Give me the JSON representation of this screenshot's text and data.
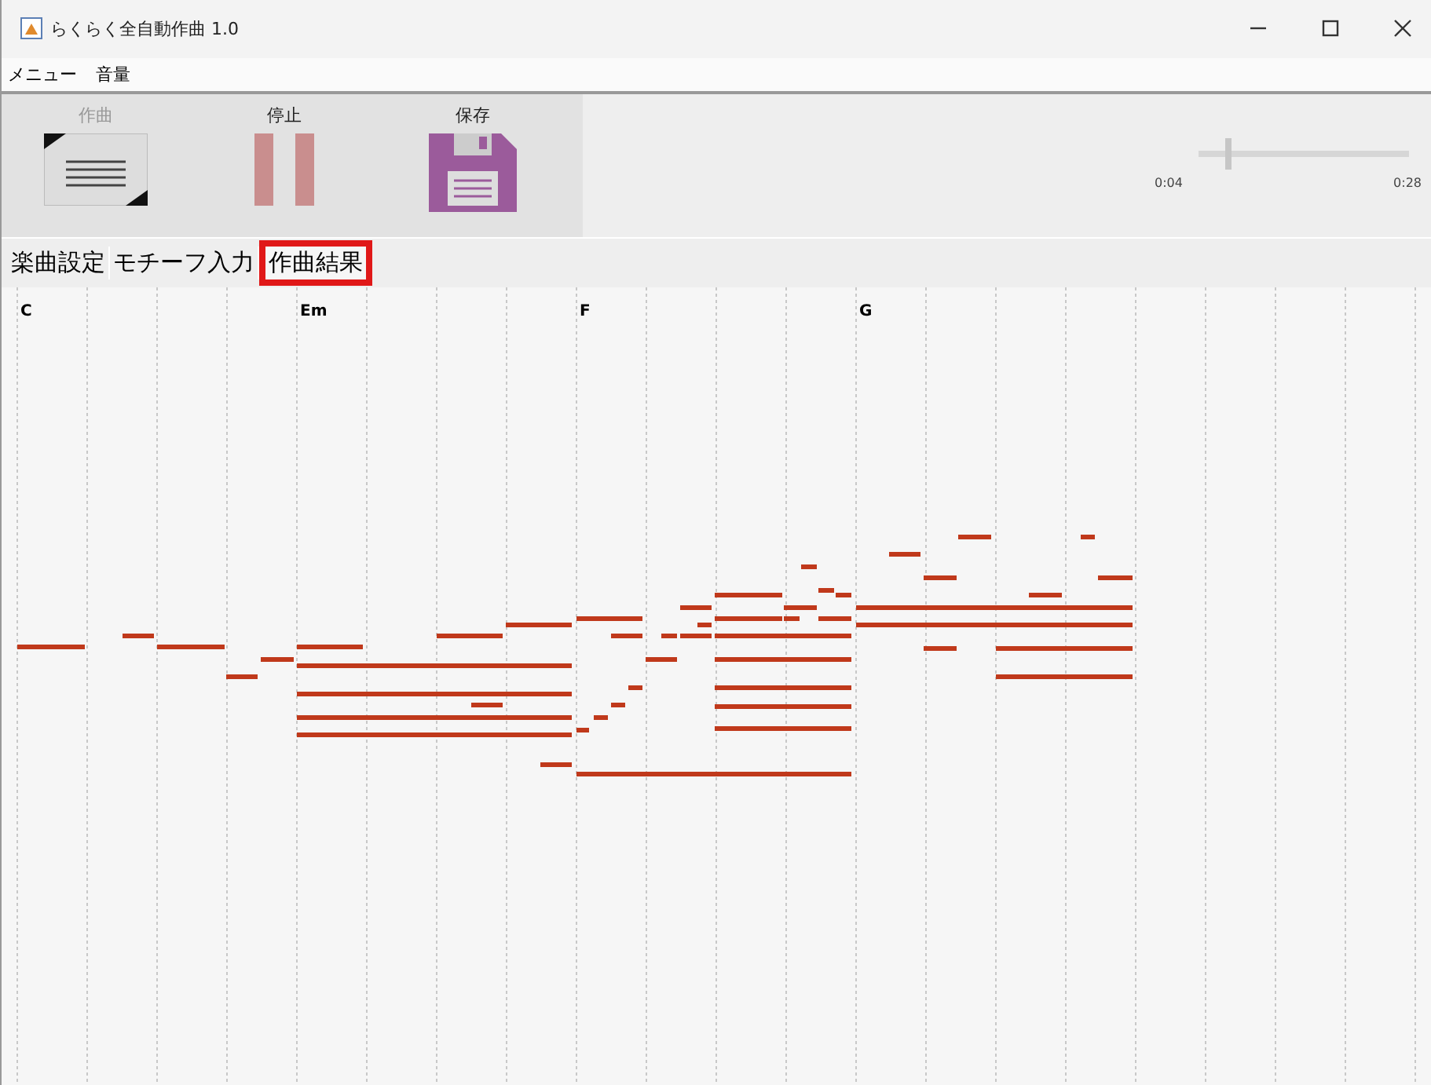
{
  "window": {
    "title": "らくらく全自動作曲 1.0"
  },
  "menu": [
    "メニュー",
    "音量"
  ],
  "toolbar": [
    {
      "label": "作曲",
      "kind": "compose",
      "disabled": true
    },
    {
      "label": "停止",
      "kind": "stop",
      "disabled": false
    },
    {
      "label": "保存",
      "kind": "save",
      "disabled": false
    }
  ],
  "position_slider": {
    "level": 0.13,
    "start": "0:04",
    "end": "0:28"
  },
  "tabs": [
    {
      "label": "楽曲設定",
      "selected": false
    },
    {
      "label": "モチーフ入力",
      "selected": false
    },
    {
      "label": "作曲結果",
      "selected": true
    }
  ],
  "chords": [
    "C",
    "Em",
    "F",
    "G"
  ]
}
